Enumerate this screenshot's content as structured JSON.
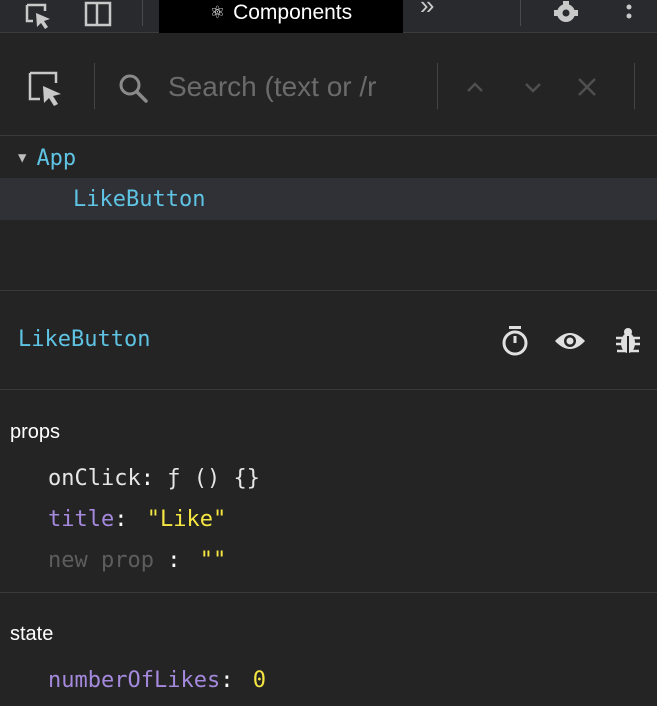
{
  "toolbar": {
    "active_tab": "Components",
    "atom_glyph": "⚛",
    "more_glyph": "»"
  },
  "search": {
    "placeholder": "Search (text or /r"
  },
  "tree": {
    "items": [
      {
        "label": "App",
        "expanded": true
      },
      {
        "label": "LikeButton",
        "selected": true
      }
    ]
  },
  "inspector": {
    "component_name": "LikeButton"
  },
  "props": {
    "label": "props",
    "entries": [
      {
        "key": "onClick",
        "value": "ƒ () {}"
      },
      {
        "key": "title",
        "value": "\"Like\""
      },
      {
        "key": "new prop",
        "value": "\"\""
      }
    ]
  },
  "state": {
    "label": "state",
    "entries": [
      {
        "key": "numberOfLikes",
        "value": "0"
      }
    ]
  },
  "colors": {
    "background": "#242424",
    "component_blue": "#5fc3e4",
    "key_purple": "#a489dd",
    "value_yellow": "#f5e642"
  }
}
